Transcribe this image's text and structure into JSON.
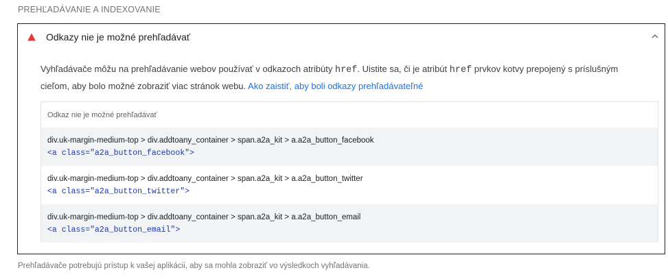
{
  "section": {
    "title": "PREHĽADÁVANIE A INDEXOVANIE"
  },
  "audit": {
    "title": "Odkazy nie je možné prehľadávať",
    "status_color": "#e53935",
    "icons": {
      "status": "warning-triangle-icon",
      "toggle": "chevron-up-icon"
    },
    "description": {
      "part1": "Vyhľadávače môžu na prehľadávanie webov používať v odkazoch atribúty ",
      "code1": "href",
      "part2": ". Uistite sa, či je atribút ",
      "code2": "href",
      "part3": " prvkov kotvy prepojený s príslušným cieľom, aby bolo možné zobraziť viac stránok webu. ",
      "link": "Ako zaistiť, aby boli odkazy prehľadávateľné"
    },
    "details": {
      "header": "Odkaz nie je možné prehľadávať",
      "rows": [
        {
          "path": "div.uk-margin-medium-top > div.addtoany_container > span.a2a_kit > a.a2a_button_facebook",
          "snippet": "<a class=\"a2a_button_facebook\">"
        },
        {
          "path": "div.uk-margin-medium-top > div.addtoany_container > span.a2a_kit > a.a2a_button_twitter",
          "snippet": "<a class=\"a2a_button_twitter\">"
        },
        {
          "path": "div.uk-margin-medium-top > div.addtoany_container > span.a2a_kit > a.a2a_button_email",
          "snippet": "<a class=\"a2a_button_email\">"
        }
      ]
    }
  },
  "footer": {
    "text": "Prehľadávače potrebujú prístup k vašej aplikácii, aby sa mohla zobraziť vo výsledkoch vyhľadávania."
  }
}
